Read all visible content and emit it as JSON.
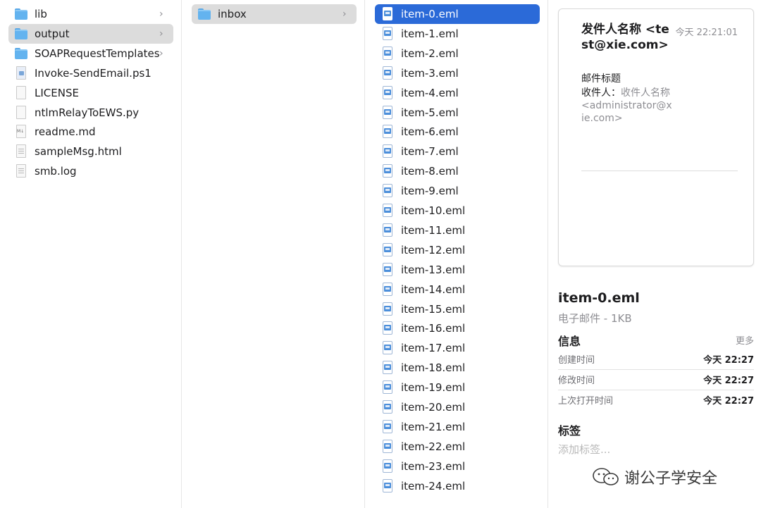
{
  "columns": {
    "col1": [
      {
        "label": "lib",
        "icon": "folder-icon",
        "folder": true,
        "selected": "none"
      },
      {
        "label": "output",
        "icon": "folder-icon",
        "folder": true,
        "selected": "gray"
      },
      {
        "label": "SOAPRequestTemplates",
        "icon": "folder-icon",
        "folder": true,
        "selected": "none"
      },
      {
        "label": "Invoke-SendEmail.ps1",
        "icon": "powershell-file-icon",
        "folder": false,
        "selected": "none"
      },
      {
        "label": "LICENSE",
        "icon": "blank-file-icon",
        "folder": false,
        "selected": "none"
      },
      {
        "label": "ntlmRelayToEWS.py",
        "icon": "blank-file-icon",
        "folder": false,
        "selected": "none"
      },
      {
        "label": "readme.md",
        "icon": "markdown-file-icon",
        "folder": false,
        "selected": "none"
      },
      {
        "label": "sampleMsg.html",
        "icon": "document-file-icon",
        "folder": false,
        "selected": "none"
      },
      {
        "label": "smb.log",
        "icon": "document-file-icon",
        "folder": false,
        "selected": "none"
      }
    ],
    "col2": [
      {
        "label": "inbox",
        "icon": "folder-icon",
        "folder": true,
        "selected": "gray"
      }
    ],
    "col3": [
      {
        "label": "item-0.eml",
        "selected": "blue"
      },
      {
        "label": "item-1.eml"
      },
      {
        "label": "item-2.eml"
      },
      {
        "label": "item-3.eml"
      },
      {
        "label": "item-4.eml"
      },
      {
        "label": "item-5.eml"
      },
      {
        "label": "item-6.eml"
      },
      {
        "label": "item-7.eml"
      },
      {
        "label": "item-8.eml"
      },
      {
        "label": "item-9.eml"
      },
      {
        "label": "item-10.eml"
      },
      {
        "label": "item-11.eml"
      },
      {
        "label": "item-12.eml"
      },
      {
        "label": "item-13.eml"
      },
      {
        "label": "item-14.eml"
      },
      {
        "label": "item-15.eml"
      },
      {
        "label": "item-16.eml"
      },
      {
        "label": "item-17.eml"
      },
      {
        "label": "item-18.eml"
      },
      {
        "label": "item-19.eml"
      },
      {
        "label": "item-20.eml"
      },
      {
        "label": "item-21.eml"
      },
      {
        "label": "item-22.eml"
      },
      {
        "label": "item-23.eml"
      },
      {
        "label": "item-24.eml"
      }
    ]
  },
  "preview": {
    "from": "发件人名称 <test@xie.com>",
    "time": "今天 22:21:01",
    "subject": "邮件标题",
    "to_label": "收件人：",
    "to_value": "收件人名称 <administrator@xie.com>"
  },
  "info": {
    "name": "item-0.eml",
    "kind": "电子邮件 - 1KB",
    "section_title": "信息",
    "more": "更多",
    "rows": [
      {
        "key": "创建时间",
        "value": "今天 22:27"
      },
      {
        "key": "修改时间",
        "value": "今天 22:27"
      },
      {
        "key": "上次打开时间",
        "value": "今天 22:27"
      }
    ],
    "tags_title": "标签",
    "tags_placeholder": "添加标签..."
  },
  "watermark": "谢公子学安全",
  "colors": {
    "selection_blue": "#2b6ad8",
    "selection_gray": "#dcdcdc",
    "folder_blue": "#63b3ef"
  }
}
